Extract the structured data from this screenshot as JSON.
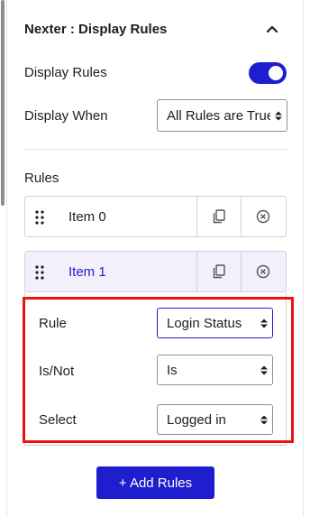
{
  "panel": {
    "title": "Nexter : Display Rules",
    "collapse_icon": "chevron-up-icon"
  },
  "display_rules": {
    "label": "Display Rules",
    "toggle_on": true,
    "toggle_color": "#1e1ecf"
  },
  "display_when": {
    "label": "Display When",
    "value": "All Rules are True"
  },
  "rules": {
    "heading": "Rules",
    "items": [
      {
        "label": "Item 0",
        "expanded": false
      },
      {
        "label": "Item 1",
        "expanded": true
      }
    ],
    "fields": {
      "rule": {
        "label": "Rule",
        "value": "Login Status"
      },
      "is_not": {
        "label": "Is/Not",
        "value": "Is"
      },
      "select": {
        "label": "Select",
        "value": "Logged in"
      }
    }
  },
  "add_button": {
    "label": "+ Add Rules"
  },
  "colors": {
    "accent": "#1e1ecf",
    "highlight": "#ee1111",
    "active_item_bg": "#f1f0fb"
  }
}
